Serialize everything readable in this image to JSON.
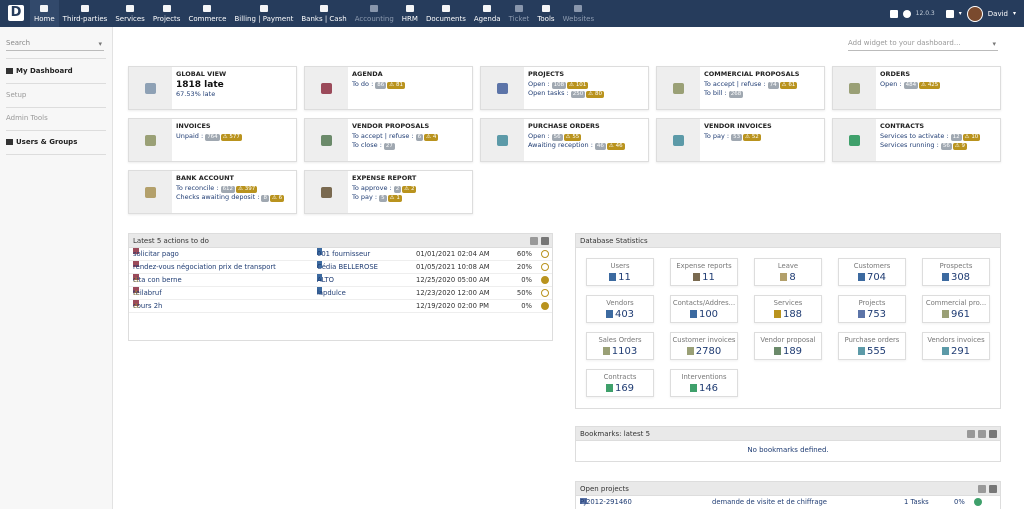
{
  "topbar": {
    "logo": "D",
    "version": "12.0.3",
    "user": "David",
    "menu": [
      {
        "label": "Home",
        "icon": "home-icon",
        "active": true
      },
      {
        "label": "Third-parties",
        "icon": "building-icon"
      },
      {
        "label": "Services",
        "icon": "cube-icon"
      },
      {
        "label": "Projects",
        "icon": "sitemap-icon"
      },
      {
        "label": "Commerce",
        "icon": "suitcase-icon"
      },
      {
        "label": "Billing | Payment",
        "icon": "money-icon"
      },
      {
        "label": "Banks | Cash",
        "icon": "bank-icon"
      },
      {
        "label": "Accounting",
        "icon": "calc-icon",
        "disabled": true
      },
      {
        "label": "HRM",
        "icon": "user-icon"
      },
      {
        "label": "Documents",
        "icon": "folder-icon"
      },
      {
        "label": "Agenda",
        "icon": "calendar-icon"
      },
      {
        "label": "Ticket",
        "icon": "ticket-icon",
        "disabled": true
      },
      {
        "label": "Tools",
        "icon": "wrench-icon"
      },
      {
        "label": "Websites",
        "icon": "globe-icon",
        "disabled": true
      }
    ]
  },
  "sidebar": {
    "search_placeholder": "Search",
    "my_dashboard": "My Dashboard",
    "setup": "Setup",
    "admin_tools": "Admin Tools",
    "users_groups": "Users & Groups"
  },
  "add_widget": "Add widget to your dashboard...",
  "boxes": [
    {
      "title": "GLOBAL VIEW",
      "big": "1818 late",
      "lines": [
        {
          "t": "67.53% late"
        }
      ],
      "color": "#8ea1b5"
    },
    {
      "title": "AGENDA",
      "lines": [
        {
          "t": "To do :",
          "g": "86",
          "w": "81"
        }
      ],
      "color": "#9b4a5a"
    },
    {
      "title": "PROJECTS",
      "lines": [
        {
          "t": "Open :",
          "g": "108",
          "w": "101"
        },
        {
          "t": "Open tasks :",
          "g": "250",
          "w": "80"
        }
      ],
      "color": "#5c74a8"
    },
    {
      "title": "COMMERCIAL PROPOSALS",
      "lines": [
        {
          "t": "To accept | refuse :",
          "g": "74",
          "w": "61"
        },
        {
          "t": "To bill :",
          "g": "268"
        }
      ],
      "color": "#9aa076"
    },
    {
      "title": "ORDERS",
      "lines": [
        {
          "t": "Open :",
          "g": "484",
          "w": "425"
        }
      ],
      "color": "#9aa076"
    },
    {
      "title": "INVOICES",
      "lines": [
        {
          "t": "Unpaid :",
          "g": "764",
          "w": "577"
        }
      ],
      "color": "#9aa076"
    },
    {
      "title": "VENDOR PROPOSALS",
      "lines": [
        {
          "t": "To accept | refuse :",
          "g": "6",
          "w": "4"
        },
        {
          "t": "To close :",
          "g": "27"
        }
      ],
      "color": "#6b8a6a"
    },
    {
      "title": "PURCHASE ORDERS",
      "lines": [
        {
          "t": "Open :",
          "g": "56",
          "w": "55"
        },
        {
          "t": "Awaiting reception :",
          "g": "46",
          "w": "46"
        }
      ],
      "color": "#5c9aa8"
    },
    {
      "title": "VENDOR INVOICES",
      "lines": [
        {
          "t": "To pay :",
          "g": "53",
          "w": "52"
        }
      ],
      "color": "#5c9aa8"
    },
    {
      "title": "CONTRACTS",
      "lines": [
        {
          "t": "Services to activate :",
          "g": "12",
          "w": "10"
        },
        {
          "t": "Services running :",
          "g": "56",
          "w": "9"
        }
      ],
      "color": "#3fa06b"
    },
    {
      "title": "BANK ACCOUNT",
      "lines": [
        {
          "t": "To reconcile :",
          "g": "612",
          "w": "397"
        },
        {
          "t": "Checks awaiting deposit :",
          "g": "8",
          "w": "6"
        }
      ],
      "color": "#b3a06b"
    },
    {
      "title": "EXPENSE REPORT",
      "lines": [
        {
          "t": "To approve :",
          "g": "2",
          "w": "2"
        },
        {
          "t": "To pay :",
          "g": "5",
          "w": "1"
        }
      ],
      "color": "#7a6a50"
    }
  ],
  "actions": {
    "title": "Latest 5 actions to do",
    "rows": [
      {
        "label": "solicitar pago",
        "warn": false,
        "company": "001 fournisseur",
        "date": "01/01/2021 02:04 AM",
        "pct": "60%",
        "filled": false
      },
      {
        "label": "rendez-vous négociation prix de transport",
        "warn": false,
        "company": "Cédia BELLEROSE",
        "date": "01/05/2021 10:08 AM",
        "pct": "20%",
        "filled": false
      },
      {
        "label": "cita con berne",
        "warn": true,
        "company": "ALTO",
        "date": "12/25/2020 05:00 AM",
        "pct": "0%",
        "filled": true
      },
      {
        "label": "teilabruf",
        "warn": true,
        "company": "lapdulce",
        "date": "12/23/2020 12:00 AM",
        "pct": "50%",
        "filled": false
      },
      {
        "label": "cours 2h",
        "warn": true,
        "company": "",
        "date": "12/19/2020 02:00 PM",
        "pct": "0%",
        "filled": true
      }
    ]
  },
  "stats": {
    "title": "Database Statistics",
    "items": [
      {
        "label": "Users",
        "value": "11",
        "color": "#3c6aa0"
      },
      {
        "label": "Expense reports",
        "value": "11",
        "color": "#7a6a50"
      },
      {
        "label": "Leave",
        "value": "8",
        "color": "#b3a06b"
      },
      {
        "label": "Customers",
        "value": "704",
        "color": "#3c6aa0"
      },
      {
        "label": "Prospects",
        "value": "308",
        "color": "#3c6aa0"
      },
      {
        "label": "Vendors",
        "value": "403",
        "color": "#3c6aa0"
      },
      {
        "label": "Contacts/Addres...",
        "value": "100",
        "color": "#3c6aa0"
      },
      {
        "label": "Services",
        "value": "188",
        "color": "#b9931e"
      },
      {
        "label": "Projects",
        "value": "753",
        "color": "#5c74a8"
      },
      {
        "label": "Commercial pro...",
        "value": "961",
        "color": "#9aa076"
      },
      {
        "label": "Sales Orders",
        "value": "1103",
        "color": "#9aa076"
      },
      {
        "label": "Customer invoices",
        "value": "2780",
        "color": "#9aa076"
      },
      {
        "label": "Vendor proposal",
        "value": "189",
        "color": "#6b8a6a"
      },
      {
        "label": "Purchase orders",
        "value": "555",
        "color": "#5c9aa8"
      },
      {
        "label": "Vendors invoices",
        "value": "291",
        "color": "#5c9aa8"
      },
      {
        "label": "Contracts",
        "value": "169",
        "color": "#3fa06b"
      },
      {
        "label": "Interventions",
        "value": "146",
        "color": "#3fa06b"
      }
    ]
  },
  "bookmarks": {
    "title": "Bookmarks: latest 5",
    "empty": "No bookmarks defined."
  },
  "openprojects": {
    "title": "Open projects",
    "ref": "PJ2012-291460",
    "desc": "demande de visite et de chiffrage",
    "tasks": "1 Tasks",
    "pct": "0%"
  }
}
